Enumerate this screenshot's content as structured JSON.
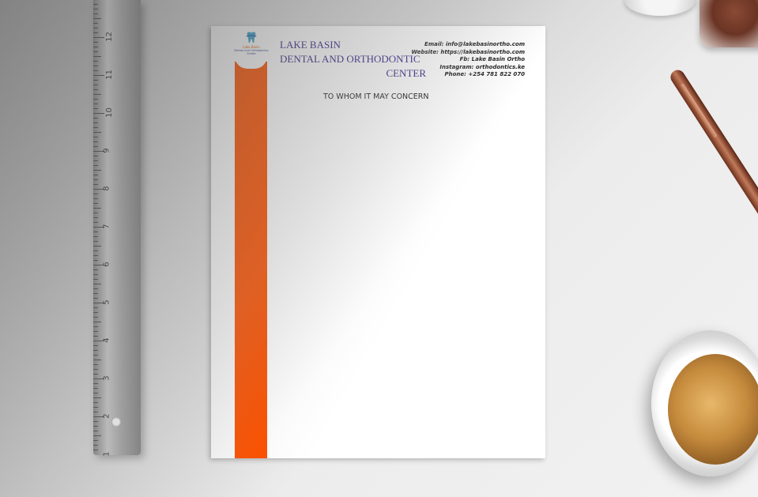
{
  "ruler": {
    "numbers": [
      "12",
      "11",
      "10",
      "9",
      "8",
      "7",
      "6",
      "5",
      "4",
      "3",
      "2",
      "1"
    ]
  },
  "letterhead": {
    "logo": {
      "line1": "Lake Basin",
      "line2": "Dental And Orthodontics",
      "line3": "Center"
    },
    "clinic_name": {
      "line1": "LAKE BASIN",
      "line2": "DENTAL AND ORTHODONTIC",
      "line3": "CENTER"
    },
    "contacts": {
      "email": "Email: info@lakebasinortho.com",
      "website": "Website: https://lakebasinortho.com",
      "facebook": "Fb: Lake Basin Ortho",
      "instagram": "Instagram: orthodontics.ke",
      "phone": "Phone: +254 781 822 070"
    },
    "salutation": "TO WHOM IT MAY CONCERN"
  },
  "colors": {
    "stripe": "#ff5200",
    "clinic_name": "#3a2a8a"
  }
}
